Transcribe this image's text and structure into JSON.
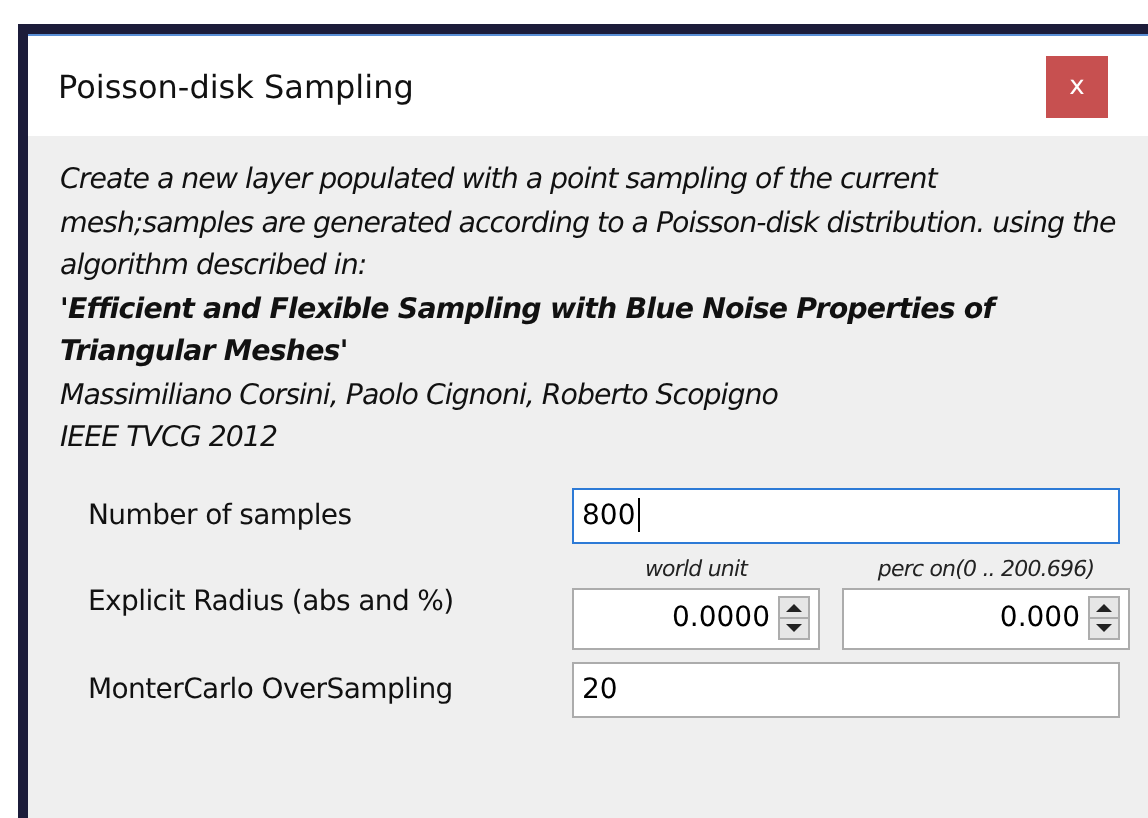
{
  "window": {
    "title": "Poisson-disk Sampling",
    "close_label": "x"
  },
  "description": "Create a new layer populated with a point sampling of the current mesh;samples are generated according to a Poisson-disk distribution. using the algorithm described in:",
  "paper_title": "'Efficient and Flexible Sampling with Blue Noise Properties of Triangular Meshes'",
  "authors": "Massimiliano Corsini, Paolo Cignoni, Roberto Scopigno",
  "venue": "IEEE TVCG 2012",
  "parameters": [
    {
      "kind": "text",
      "label": "Number of samples",
      "value": "800",
      "focused": true
    },
    {
      "kind": "spinpair",
      "label": "Explicit Radius (abs and %)",
      "fields": [
        {
          "caption": "world unit",
          "value": "0.0000"
        },
        {
          "caption": "perc on(0 .. 200.696)",
          "value": "0.000"
        }
      ]
    },
    {
      "kind": "text",
      "label": "MonterCarlo OverSampling",
      "value": "20",
      "focused": false
    }
  ]
}
